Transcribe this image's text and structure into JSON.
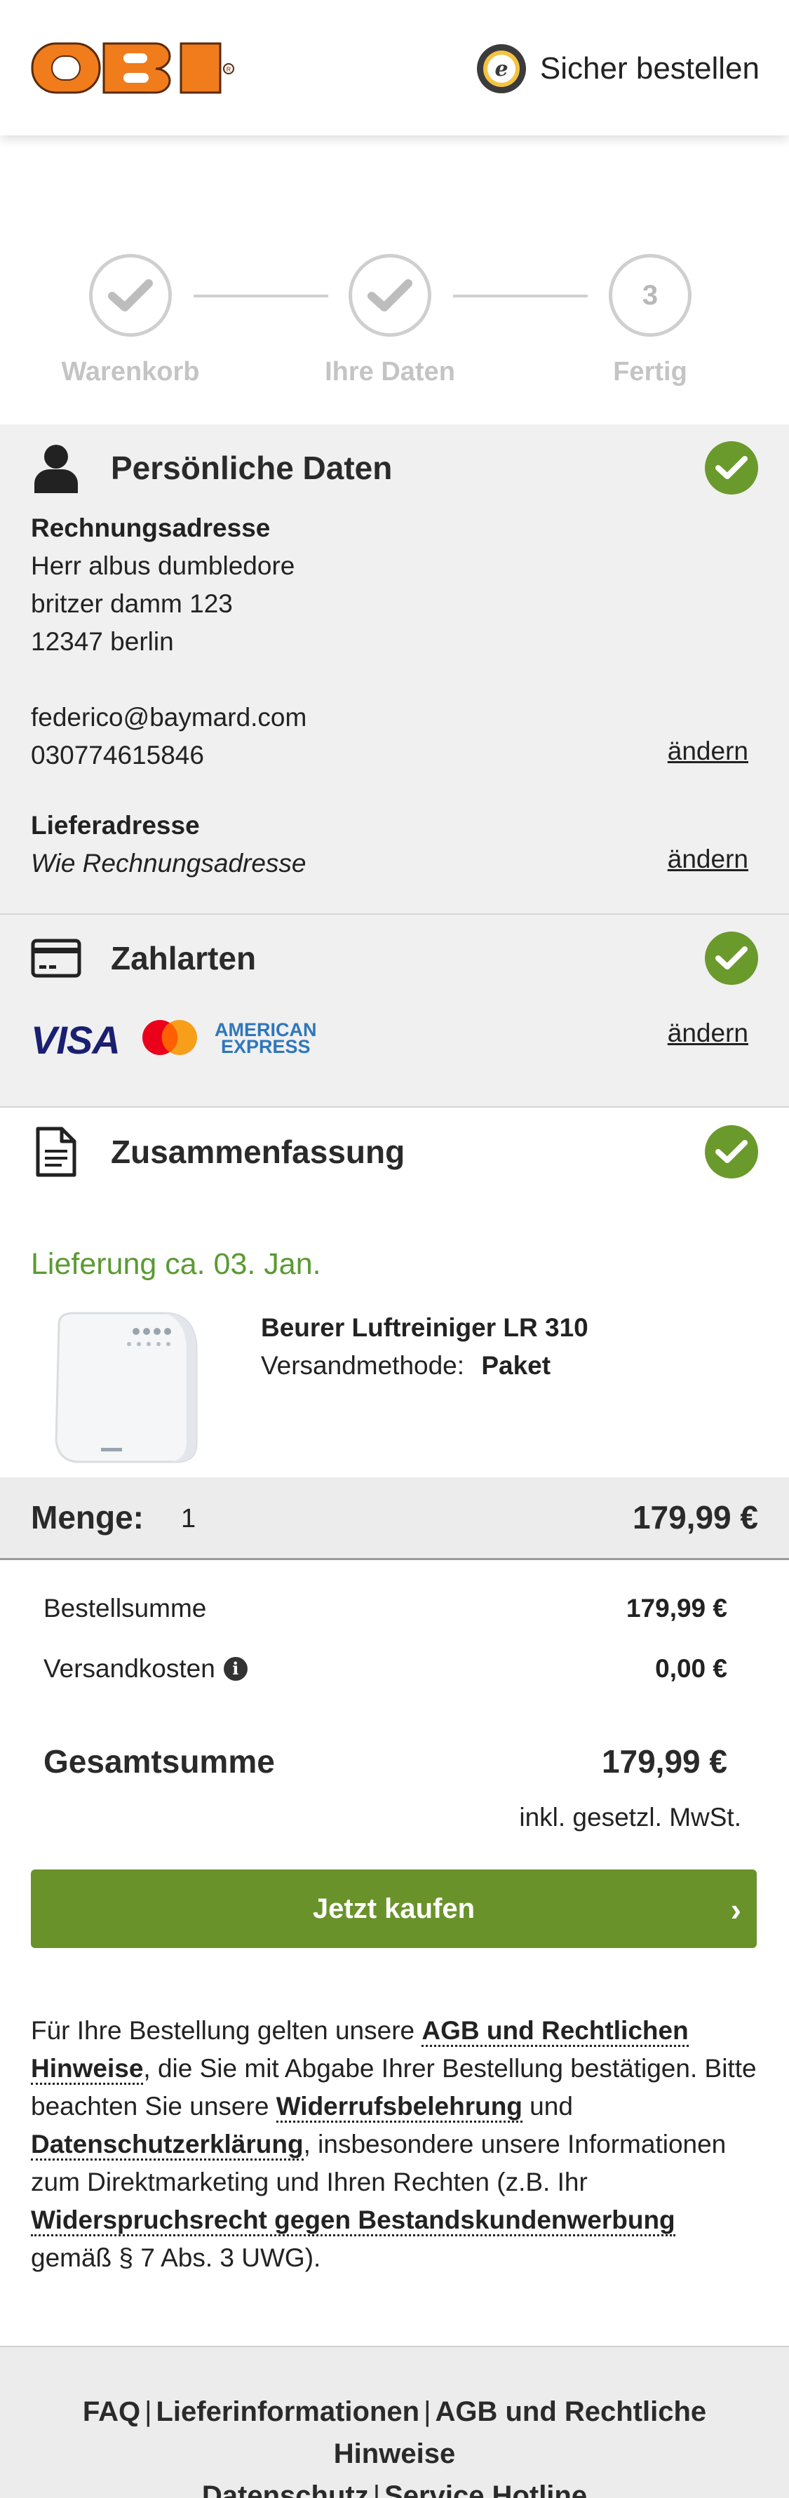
{
  "header": {
    "logo_text": "OBI",
    "trust_label": "Sicher bestellen",
    "trust_seal_letter": "e"
  },
  "steps": [
    {
      "label": "Warenkorb",
      "state": "done"
    },
    {
      "label": "Ihre Daten",
      "state": "done"
    },
    {
      "label": "Fertig",
      "number": "3",
      "state": "pending"
    }
  ],
  "personal": {
    "title": "Persönliche Daten",
    "billing_heading": "Rechnungsadresse",
    "name": "Herr albus dumbledore",
    "street": "britzer damm 123",
    "city": "12347 berlin",
    "email": "federico@baymard.com",
    "phone": "030774615846",
    "change_label": "ändern",
    "shipping_heading": "Lieferadresse",
    "shipping_value": "Wie Rechnungsadresse",
    "shipping_change_label": "ändern"
  },
  "payment": {
    "title": "Zahlarten",
    "visa": "VISA",
    "amex_line1": "AMERICAN",
    "amex_line2": "EXPRESS",
    "change_label": "ändern"
  },
  "summary": {
    "title": "Zusammenfassung",
    "delivery": "Lieferung ca. 03. Jan.",
    "product_name": "Beurer Luftreiniger LR 310",
    "shipping_method_label": "Versandmethode:",
    "shipping_method_value": "Paket",
    "qty_label": "Menge:",
    "qty_value": "1",
    "qty_price": "179,99 €",
    "order_sum_label": "Bestellsumme",
    "order_sum_value": "179,99 €",
    "shipping_cost_label": "Versandkosten",
    "shipping_cost_value": "0,00 €",
    "total_label": "Gesamtsumme",
    "total_value": "179,99 €",
    "vat_note": "inkl. gesetzl. MwSt."
  },
  "cta": {
    "buy_label": "Jetzt kaufen",
    "chevron": "›"
  },
  "legal": {
    "t1": "Für Ihre Bestellung gelten unsere ",
    "l1": "AGB und Rechtlichen Hinweise",
    "t2": ", die Sie mit Abgabe Ihrer Bestellung bestätigen. Bitte beachten Sie unsere ",
    "l2": "Widerrufsbelehrung",
    "t3": " und ",
    "l3": "Datenschutzerklärung",
    "t4": ", insbesondere unsere Informationen zum Direktmarketing und Ihren Rechten (z.B. Ihr ",
    "l4": "Widerspruchsrecht gegen Bestandskundenwerbung",
    "t5": " gemäß § 7 Abs. 3 UWG)."
  },
  "footer": {
    "links": [
      "FAQ",
      "Lieferinformationen",
      "AGB und Rechtliche Hinweise",
      "Datenschutz",
      "Service Hotline"
    ],
    "separator": "|"
  },
  "colors": {
    "obi_orange": "#f07c1b",
    "success_green": "#6a9a2b",
    "buy_green": "#6a922b",
    "delivery_green": "#5a9a32"
  }
}
